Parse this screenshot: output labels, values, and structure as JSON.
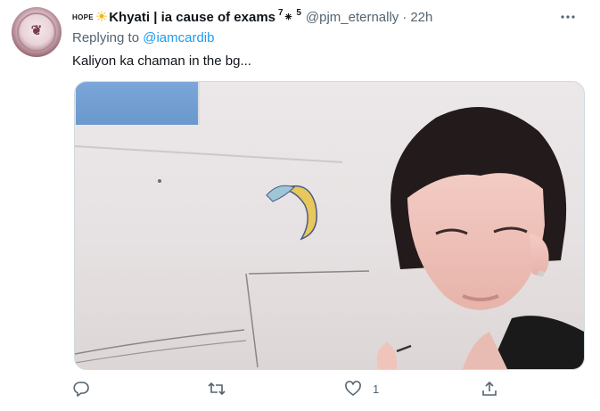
{
  "tweet": {
    "author": {
      "prefix": "HOPE",
      "sun_icon": "sun-icon",
      "display_name": "Khyati | ia cause of exams",
      "sup_seven": "7",
      "flower_icon": "⁕",
      "sup_five": "5",
      "handle": "@pjm_eternally",
      "separator": "·",
      "time": "22h"
    },
    "replying_prefix": "Replying to",
    "replying_to": "@iamcardib",
    "text": "Kaliyon ka chaman in the bg...",
    "actions": {
      "reply_icon": "reply-icon",
      "retweet_icon": "retweet-icon",
      "like_icon": "heart-icon",
      "like_count": "1",
      "share_icon": "share-icon"
    },
    "more_icon": "more-icon"
  },
  "colors": {
    "text_primary": "#0f1419",
    "text_secondary": "#536471",
    "accent": "#1d9bf0",
    "border": "#cfd9de"
  }
}
